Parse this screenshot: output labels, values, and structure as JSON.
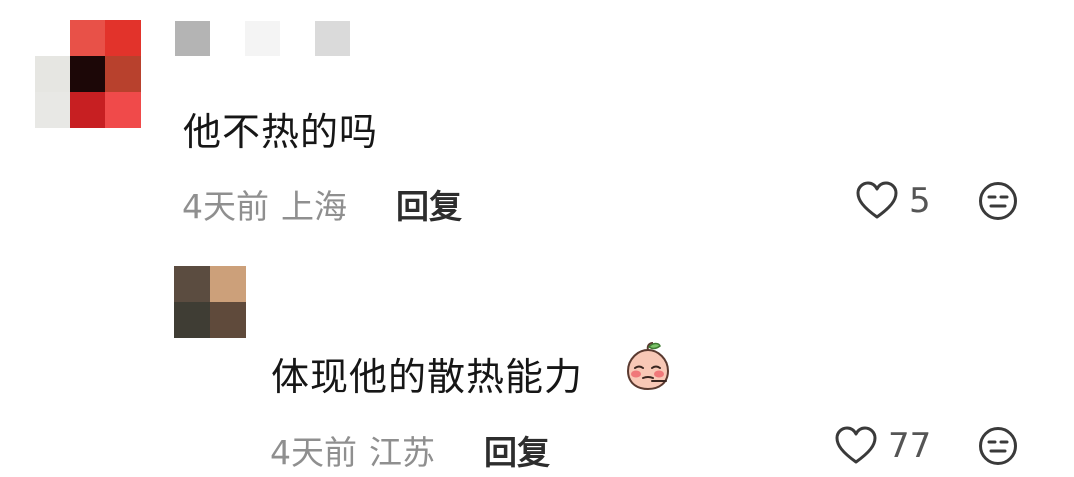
{
  "comment": {
    "author_hidden": true,
    "text": "他不热的吗",
    "time": "4天前",
    "location": "上海",
    "reply_label": "回复",
    "likes": "5"
  },
  "reply": {
    "author_hidden": true,
    "text": "体现他的散热能力",
    "sticker": "peach-blush-sticker",
    "time": "4天前",
    "location": "江苏",
    "reply_label": "回复",
    "likes": "77"
  },
  "icons": {
    "like": "heart-outline-icon",
    "react": "neutral-face-icon"
  },
  "colors": {
    "text": "#161616",
    "meta": "#8f8f8f",
    "icon": "#3a3a3a"
  }
}
